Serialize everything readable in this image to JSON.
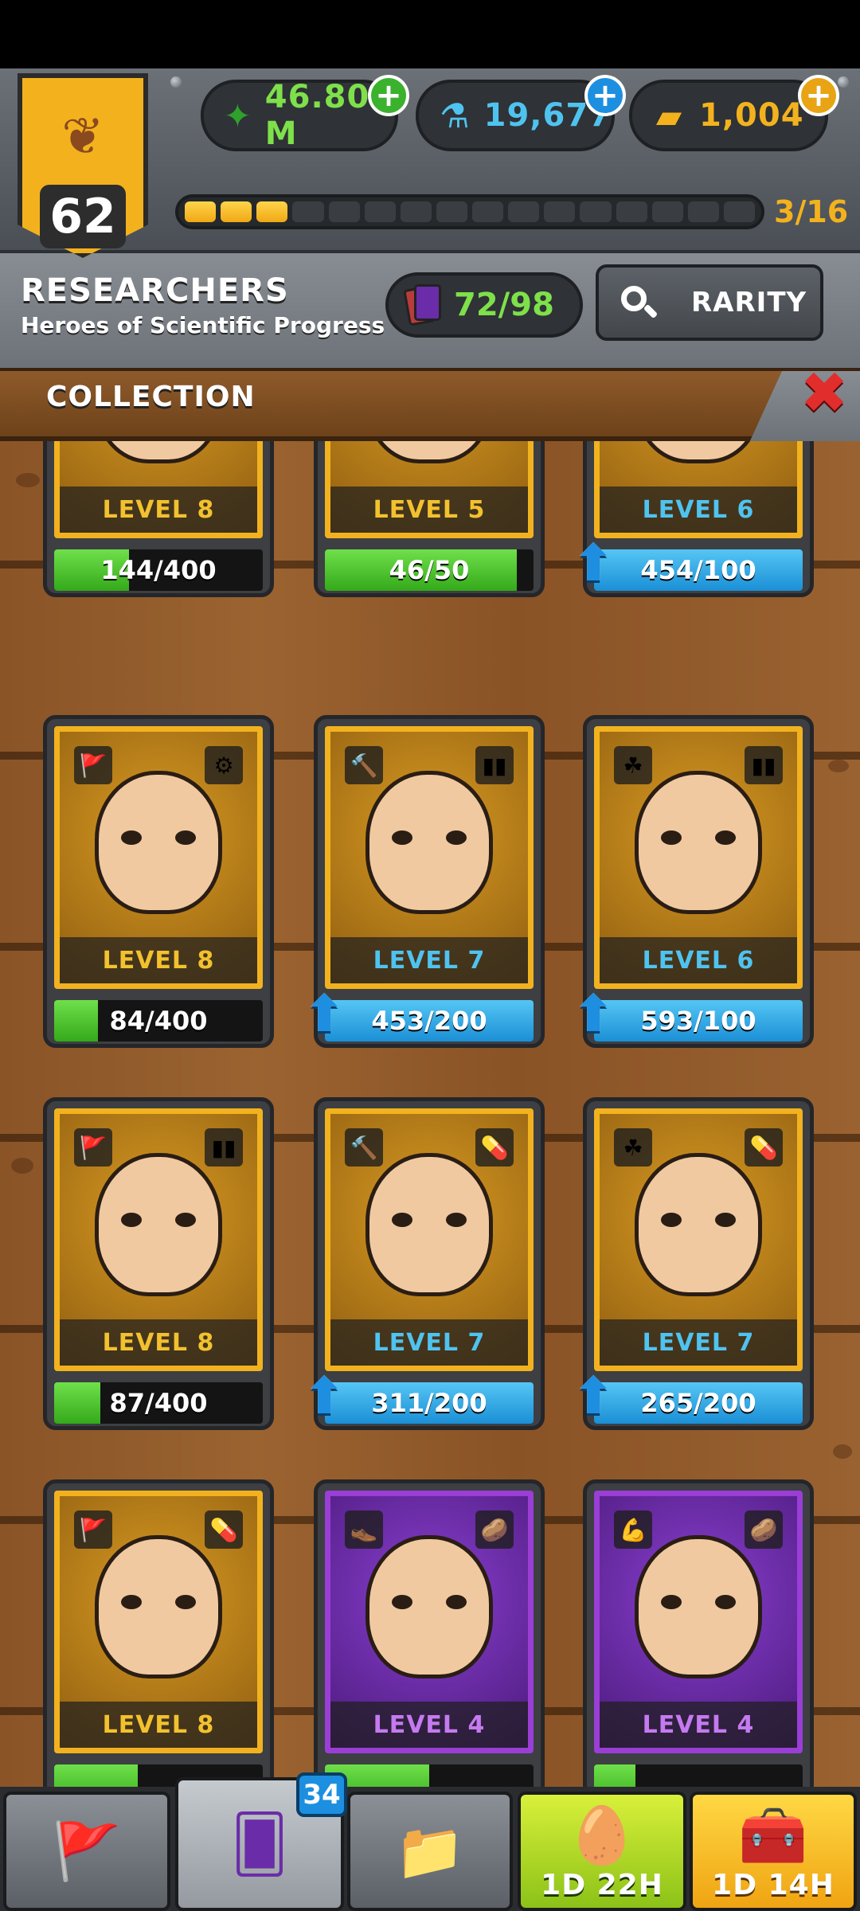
{
  "player": {
    "level": "62"
  },
  "currencies": [
    {
      "name": "cash",
      "icon": "cash-icon",
      "value": "46.80 M",
      "color": "#7ee04a",
      "glyph": "💵"
    },
    {
      "name": "science",
      "icon": "flask-icon",
      "value": "19,677",
      "color": "#4fc3f0",
      "glyph": "⚗"
    },
    {
      "name": "gold",
      "icon": "gold-bar-icon",
      "value": "1,004",
      "color": "#f3b21d",
      "glyph": "▰"
    }
  ],
  "progress": {
    "filled": 3,
    "total": 16,
    "label": "3/16"
  },
  "section": {
    "title": "RESEARCHERS",
    "subtitle": "Heroes of Scientific Progress"
  },
  "cards_owned": "72/98",
  "rarity_button": "RARITY",
  "collection_label": "COLLECTION",
  "cards": [
    {
      "level": "LEVEL 8",
      "level_color": "gold",
      "rarity": "legendary",
      "progress": "144/400",
      "fill": 0.36,
      "bar": "green",
      "upgrade": false,
      "badge_l": "",
      "badge_r": ""
    },
    {
      "level": "LEVEL 5",
      "level_color": "gold",
      "rarity": "legendary",
      "progress": "46/50",
      "fill": 0.92,
      "bar": "green",
      "upgrade": false,
      "badge_l": "",
      "badge_r": ""
    },
    {
      "level": "LEVEL 6",
      "level_color": "blue",
      "rarity": "legendary",
      "progress": "454/100",
      "fill": 1,
      "bar": "blue",
      "upgrade": true,
      "badge_l": "",
      "badge_r": ""
    },
    {
      "level": "LEVEL 8",
      "level_color": "gold",
      "rarity": "legendary",
      "progress": "84/400",
      "fill": 0.21,
      "bar": "green",
      "upgrade": false,
      "badge_l": "🚩",
      "badge_r": "⚙"
    },
    {
      "level": "LEVEL 7",
      "level_color": "blue",
      "rarity": "legendary",
      "progress": "453/200",
      "fill": 1,
      "bar": "blue",
      "upgrade": true,
      "badge_l": "🔨",
      "badge_r": "▮▮"
    },
    {
      "level": "LEVEL 6",
      "level_color": "blue",
      "rarity": "legendary",
      "progress": "593/100",
      "fill": 1,
      "bar": "blue",
      "upgrade": true,
      "badge_l": "☘",
      "badge_r": "▮▮"
    },
    {
      "level": "LEVEL 8",
      "level_color": "gold",
      "rarity": "legendary",
      "progress": "87/400",
      "fill": 0.22,
      "bar": "green",
      "upgrade": false,
      "badge_l": "🚩",
      "badge_r": "▮▮"
    },
    {
      "level": "LEVEL 7",
      "level_color": "blue",
      "rarity": "legendary",
      "progress": "311/200",
      "fill": 1,
      "bar": "blue",
      "upgrade": true,
      "badge_l": "🔨",
      "badge_r": "💊"
    },
    {
      "level": "LEVEL 7",
      "level_color": "blue",
      "rarity": "legendary",
      "progress": "265/200",
      "fill": 1,
      "bar": "blue",
      "upgrade": true,
      "badge_l": "☘",
      "badge_r": "💊"
    },
    {
      "level": "LEVEL 8",
      "level_color": "gold",
      "rarity": "legendary",
      "progress": "",
      "fill": 0.4,
      "bar": "green",
      "upgrade": false,
      "badge_l": "🚩",
      "badge_r": "💊"
    },
    {
      "level": "LEVEL 4",
      "level_color": "purple",
      "rarity": "epic",
      "progress": "",
      "fill": 0.5,
      "bar": "green",
      "upgrade": false,
      "badge_l": "👞",
      "badge_r": "🥔"
    },
    {
      "level": "LEVEL 4",
      "level_color": "purple",
      "rarity": "epic",
      "progress": "",
      "fill": 0.2,
      "bar": "green",
      "upgrade": false,
      "badge_l": "💪",
      "badge_r": "🥔"
    }
  ],
  "nav": {
    "cards_badge": "34",
    "egg_timer": "1D 22H",
    "chest_timer": "1D 14H"
  }
}
